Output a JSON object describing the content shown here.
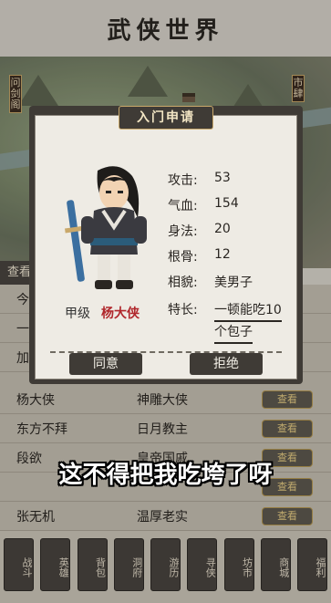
{
  "app": {
    "title": "武侠世界"
  },
  "map": {
    "labels": [
      "问剑阁",
      "市肆"
    ]
  },
  "side_tab": {
    "label": "查看"
  },
  "list": {
    "rows": [
      {
        "name": "今",
        "trait": "",
        "action": ""
      },
      {
        "name": "一",
        "trait": "",
        "action": ""
      },
      {
        "name": "加",
        "trait": "",
        "action": ""
      },
      {
        "name": "杨大侠",
        "trait": "神雕大侠",
        "action": "查看"
      },
      {
        "name": "东方不拜",
        "trait": "日月教主",
        "action": "查看"
      },
      {
        "name": "段欲",
        "trait": "皇帝国戚",
        "action": "查看"
      },
      {
        "name": "",
        "trait": "",
        "action": "查看"
      },
      {
        "name": "张无机",
        "trait": "温厚老实",
        "action": "查看"
      }
    ]
  },
  "caption": "这不得把我吃垮了呀",
  "nav": {
    "items": [
      "战斗",
      "英雄",
      "背包",
      "洞府",
      "游历",
      "寻侠",
      "坊市",
      "商城",
      "福利"
    ]
  },
  "dialog": {
    "title": "入门申请",
    "rank": "甲级",
    "hero_name": "杨大侠",
    "stats": [
      {
        "label": "攻击:",
        "value": "53"
      },
      {
        "label": "气血:",
        "value": "154"
      },
      {
        "label": "身法:",
        "value": "20"
      },
      {
        "label": "根骨:",
        "value": "12"
      },
      {
        "label": "相貌:",
        "value": "美男子"
      },
      {
        "label": "特长:",
        "value": "一顿能吃10"
      }
    ],
    "specialty_line2": "个包子",
    "accept_label": "同意",
    "reject_label": "拒绝"
  },
  "colors": {
    "accent_red": "#b0262b",
    "panel_dark": "#3f3b36",
    "gold": "#c9a86a"
  }
}
